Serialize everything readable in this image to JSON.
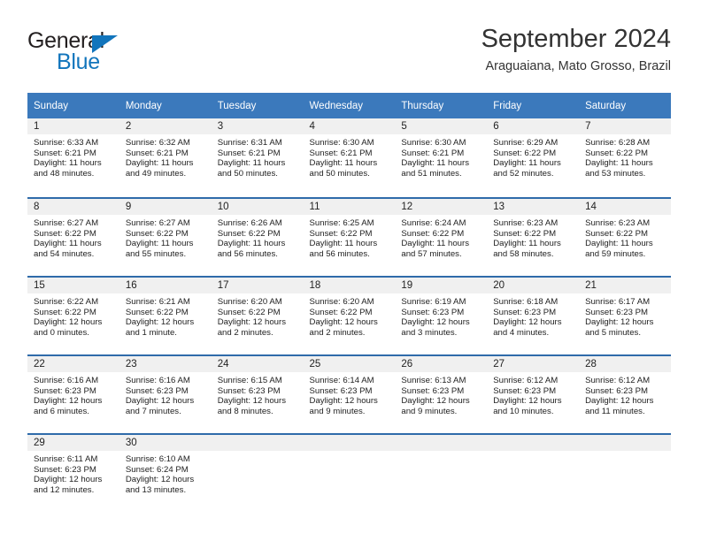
{
  "logo": {
    "word1": "General",
    "word2": "Blue",
    "triangle_color": "#1275bc"
  },
  "header": {
    "title": "September 2024",
    "subtitle": "Araguaiana, Mato Grosso, Brazil"
  },
  "theme": {
    "header_bg": "#3b79bc",
    "row_divider": "#2f6baa",
    "daynum_bg": "#f0f0f0",
    "text": "#222222"
  },
  "weekdays": [
    "Sunday",
    "Monday",
    "Tuesday",
    "Wednesday",
    "Thursday",
    "Friday",
    "Saturday"
  ],
  "weeks": [
    [
      {
        "day": "1",
        "sunrise": "Sunrise: 6:33 AM",
        "sunset": "Sunset: 6:21 PM",
        "daylight1": "Daylight: 11 hours",
        "daylight2": "and 48 minutes."
      },
      {
        "day": "2",
        "sunrise": "Sunrise: 6:32 AM",
        "sunset": "Sunset: 6:21 PM",
        "daylight1": "Daylight: 11 hours",
        "daylight2": "and 49 minutes."
      },
      {
        "day": "3",
        "sunrise": "Sunrise: 6:31 AM",
        "sunset": "Sunset: 6:21 PM",
        "daylight1": "Daylight: 11 hours",
        "daylight2": "and 50 minutes."
      },
      {
        "day": "4",
        "sunrise": "Sunrise: 6:30 AM",
        "sunset": "Sunset: 6:21 PM",
        "daylight1": "Daylight: 11 hours",
        "daylight2": "and 50 minutes."
      },
      {
        "day": "5",
        "sunrise": "Sunrise: 6:30 AM",
        "sunset": "Sunset: 6:21 PM",
        "daylight1": "Daylight: 11 hours",
        "daylight2": "and 51 minutes."
      },
      {
        "day": "6",
        "sunrise": "Sunrise: 6:29 AM",
        "sunset": "Sunset: 6:22 PM",
        "daylight1": "Daylight: 11 hours",
        "daylight2": "and 52 minutes."
      },
      {
        "day": "7",
        "sunrise": "Sunrise: 6:28 AM",
        "sunset": "Sunset: 6:22 PM",
        "daylight1": "Daylight: 11 hours",
        "daylight2": "and 53 minutes."
      }
    ],
    [
      {
        "day": "8",
        "sunrise": "Sunrise: 6:27 AM",
        "sunset": "Sunset: 6:22 PM",
        "daylight1": "Daylight: 11 hours",
        "daylight2": "and 54 minutes."
      },
      {
        "day": "9",
        "sunrise": "Sunrise: 6:27 AM",
        "sunset": "Sunset: 6:22 PM",
        "daylight1": "Daylight: 11 hours",
        "daylight2": "and 55 minutes."
      },
      {
        "day": "10",
        "sunrise": "Sunrise: 6:26 AM",
        "sunset": "Sunset: 6:22 PM",
        "daylight1": "Daylight: 11 hours",
        "daylight2": "and 56 minutes."
      },
      {
        "day": "11",
        "sunrise": "Sunrise: 6:25 AM",
        "sunset": "Sunset: 6:22 PM",
        "daylight1": "Daylight: 11 hours",
        "daylight2": "and 56 minutes."
      },
      {
        "day": "12",
        "sunrise": "Sunrise: 6:24 AM",
        "sunset": "Sunset: 6:22 PM",
        "daylight1": "Daylight: 11 hours",
        "daylight2": "and 57 minutes."
      },
      {
        "day": "13",
        "sunrise": "Sunrise: 6:23 AM",
        "sunset": "Sunset: 6:22 PM",
        "daylight1": "Daylight: 11 hours",
        "daylight2": "and 58 minutes."
      },
      {
        "day": "14",
        "sunrise": "Sunrise: 6:23 AM",
        "sunset": "Sunset: 6:22 PM",
        "daylight1": "Daylight: 11 hours",
        "daylight2": "and 59 minutes."
      }
    ],
    [
      {
        "day": "15",
        "sunrise": "Sunrise: 6:22 AM",
        "sunset": "Sunset: 6:22 PM",
        "daylight1": "Daylight: 12 hours",
        "daylight2": "and 0 minutes."
      },
      {
        "day": "16",
        "sunrise": "Sunrise: 6:21 AM",
        "sunset": "Sunset: 6:22 PM",
        "daylight1": "Daylight: 12 hours",
        "daylight2": "and 1 minute."
      },
      {
        "day": "17",
        "sunrise": "Sunrise: 6:20 AM",
        "sunset": "Sunset: 6:22 PM",
        "daylight1": "Daylight: 12 hours",
        "daylight2": "and 2 minutes."
      },
      {
        "day": "18",
        "sunrise": "Sunrise: 6:20 AM",
        "sunset": "Sunset: 6:22 PM",
        "daylight1": "Daylight: 12 hours",
        "daylight2": "and 2 minutes."
      },
      {
        "day": "19",
        "sunrise": "Sunrise: 6:19 AM",
        "sunset": "Sunset: 6:23 PM",
        "daylight1": "Daylight: 12 hours",
        "daylight2": "and 3 minutes."
      },
      {
        "day": "20",
        "sunrise": "Sunrise: 6:18 AM",
        "sunset": "Sunset: 6:23 PM",
        "daylight1": "Daylight: 12 hours",
        "daylight2": "and 4 minutes."
      },
      {
        "day": "21",
        "sunrise": "Sunrise: 6:17 AM",
        "sunset": "Sunset: 6:23 PM",
        "daylight1": "Daylight: 12 hours",
        "daylight2": "and 5 minutes."
      }
    ],
    [
      {
        "day": "22",
        "sunrise": "Sunrise: 6:16 AM",
        "sunset": "Sunset: 6:23 PM",
        "daylight1": "Daylight: 12 hours",
        "daylight2": "and 6 minutes."
      },
      {
        "day": "23",
        "sunrise": "Sunrise: 6:16 AM",
        "sunset": "Sunset: 6:23 PM",
        "daylight1": "Daylight: 12 hours",
        "daylight2": "and 7 minutes."
      },
      {
        "day": "24",
        "sunrise": "Sunrise: 6:15 AM",
        "sunset": "Sunset: 6:23 PM",
        "daylight1": "Daylight: 12 hours",
        "daylight2": "and 8 minutes."
      },
      {
        "day": "25",
        "sunrise": "Sunrise: 6:14 AM",
        "sunset": "Sunset: 6:23 PM",
        "daylight1": "Daylight: 12 hours",
        "daylight2": "and 9 minutes."
      },
      {
        "day": "26",
        "sunrise": "Sunrise: 6:13 AM",
        "sunset": "Sunset: 6:23 PM",
        "daylight1": "Daylight: 12 hours",
        "daylight2": "and 9 minutes."
      },
      {
        "day": "27",
        "sunrise": "Sunrise: 6:12 AM",
        "sunset": "Sunset: 6:23 PM",
        "daylight1": "Daylight: 12 hours",
        "daylight2": "and 10 minutes."
      },
      {
        "day": "28",
        "sunrise": "Sunrise: 6:12 AM",
        "sunset": "Sunset: 6:23 PM",
        "daylight1": "Daylight: 12 hours",
        "daylight2": "and 11 minutes."
      }
    ],
    [
      {
        "day": "29",
        "sunrise": "Sunrise: 6:11 AM",
        "sunset": "Sunset: 6:23 PM",
        "daylight1": "Daylight: 12 hours",
        "daylight2": "and 12 minutes."
      },
      {
        "day": "30",
        "sunrise": "Sunrise: 6:10 AM",
        "sunset": "Sunset: 6:24 PM",
        "daylight1": "Daylight: 12 hours",
        "daylight2": "and 13 minutes."
      },
      {
        "day": "",
        "sunrise": "",
        "sunset": "",
        "daylight1": "",
        "daylight2": ""
      },
      {
        "day": "",
        "sunrise": "",
        "sunset": "",
        "daylight1": "",
        "daylight2": ""
      },
      {
        "day": "",
        "sunrise": "",
        "sunset": "",
        "daylight1": "",
        "daylight2": ""
      },
      {
        "day": "",
        "sunrise": "",
        "sunset": "",
        "daylight1": "",
        "daylight2": ""
      },
      {
        "day": "",
        "sunrise": "",
        "sunset": "",
        "daylight1": "",
        "daylight2": ""
      }
    ]
  ]
}
